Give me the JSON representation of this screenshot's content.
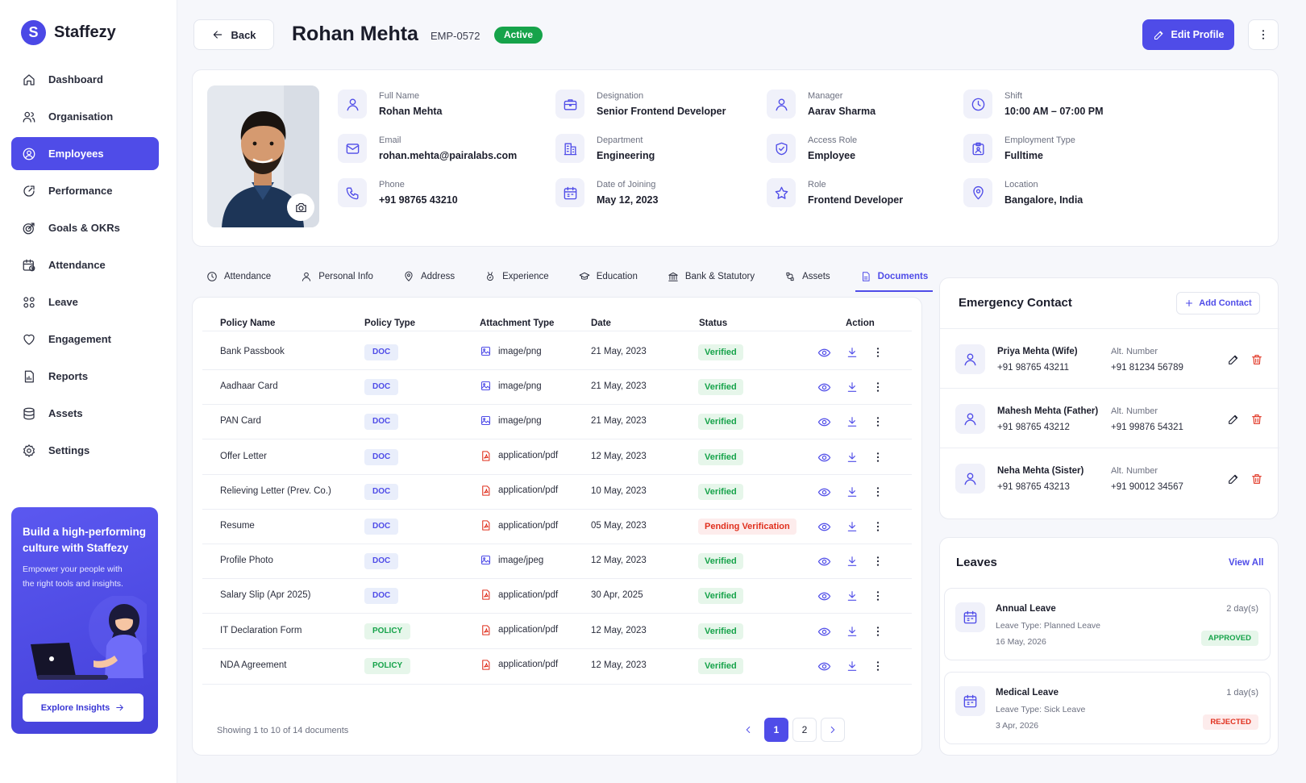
{
  "brand": {
    "logo_letter": "S",
    "name": "Staffezy"
  },
  "nav": [
    {
      "label": "Dashboard",
      "icon": "home-icon"
    },
    {
      "label": "Organisation",
      "icon": "org-icon"
    },
    {
      "label": "Employees",
      "icon": "users-icon",
      "active": true
    },
    {
      "label": "Performance",
      "icon": "gauge-icon"
    },
    {
      "label": "Goals & OKRs",
      "icon": "target-icon"
    },
    {
      "label": "Attendance",
      "icon": "calendar-clock-icon"
    },
    {
      "label": "Leave",
      "icon": "grid-icon"
    },
    {
      "label": "Engagement",
      "icon": "heart-icon"
    },
    {
      "label": "Reports",
      "icon": "file-chart-icon"
    },
    {
      "label": "Assets",
      "icon": "database-icon"
    },
    {
      "label": "Settings",
      "icon": "gear-icon"
    }
  ],
  "promo": {
    "title": "Build a high-performing culture with Staffezy",
    "text": "Empower your people with the right tools and insights.",
    "button": "Explore Insights"
  },
  "header": {
    "back": "Back",
    "name": "Rohan Mehta",
    "code": "EMP-0572",
    "status": "Active",
    "edit": "Edit Profile"
  },
  "profile": {
    "fields": [
      {
        "label": "Full Name",
        "value": "Rohan Mehta",
        "icon": "user-icon"
      },
      {
        "label": "Email",
        "value": "rohan.mehta@pairalabs.com",
        "icon": "mail-icon"
      },
      {
        "label": "Phone",
        "value": "+91 98765 43210",
        "icon": "phone-icon"
      },
      {
        "label": "Designation",
        "value": "Senior Frontend Developer",
        "icon": "briefcase-icon"
      },
      {
        "label": "Department",
        "value": "Engineering",
        "icon": "building-icon"
      },
      {
        "label": "Date of Joining",
        "value": "May 12, 2023",
        "icon": "calendar-icon"
      },
      {
        "label": "Manager",
        "value": "Aarav Sharma",
        "icon": "user-icon"
      },
      {
        "label": "Access Role",
        "value": "Employee",
        "icon": "shield-icon"
      },
      {
        "label": "Role",
        "value": "Frontend Developer",
        "icon": "star-icon"
      },
      {
        "label": "Shift",
        "value": "10:00 AM – 07:00 PM",
        "icon": "clock-icon"
      },
      {
        "label": "Employment Type",
        "value": "Fulltime",
        "icon": "id-badge-icon"
      },
      {
        "label": "Location",
        "value": "Bangalore, India",
        "icon": "pin-icon"
      }
    ]
  },
  "tabs": [
    {
      "label": "Attendance",
      "icon": "clock-icon"
    },
    {
      "label": "Personal Info",
      "icon": "user-icon"
    },
    {
      "label": "Address",
      "icon": "pin-icon"
    },
    {
      "label": "Experience",
      "icon": "medal-icon"
    },
    {
      "label": "Education",
      "icon": "cap-icon"
    },
    {
      "label": "Bank & Statutory",
      "icon": "bank-icon"
    },
    {
      "label": "Assets",
      "icon": "assets-icon"
    },
    {
      "label": "Documents",
      "icon": "document-icon",
      "active": true
    }
  ],
  "documents": {
    "columns": [
      "Policy Name",
      "Policy Type",
      "Attachment Type",
      "Date",
      "Status",
      "Action"
    ],
    "rows": [
      {
        "name": "Bank Passbook",
        "type": "DOC",
        "attachment": "image/png",
        "date": "21 May, 2023",
        "status": "Verified"
      },
      {
        "name": "Aadhaar Card",
        "type": "DOC",
        "attachment": "image/png",
        "date": "21 May, 2023",
        "status": "Verified"
      },
      {
        "name": "PAN Card",
        "type": "DOC",
        "attachment": "image/png",
        "date": "21 May, 2023",
        "status": "Verified"
      },
      {
        "name": "Offer Letter",
        "type": "DOC",
        "attachment": "application/pdf",
        "date": "12 May, 2023",
        "status": "Verified"
      },
      {
        "name": "Relieving Letter (Prev. Co.)",
        "type": "DOC",
        "attachment": "application/pdf",
        "date": "10 May, 2023",
        "status": "Verified"
      },
      {
        "name": "Resume",
        "type": "DOC",
        "attachment": "application/pdf",
        "date": "05 May, 2023",
        "status": "Pending Verification"
      },
      {
        "name": "Profile Photo",
        "type": "DOC",
        "attachment": "image/jpeg",
        "date": "12 May, 2023",
        "status": "Verified"
      },
      {
        "name": "Salary Slip (Apr 2025)",
        "type": "DOC",
        "attachment": "application/pdf",
        "date": "30 Apr, 2025",
        "status": "Verified"
      },
      {
        "name": "IT Declaration Form",
        "type": "POLICY",
        "attachment": "application/pdf",
        "date": "12 May, 2023",
        "status": "Verified"
      },
      {
        "name": "NDA Agreement",
        "type": "POLICY",
        "attachment": "application/pdf",
        "date": "12 May, 2023",
        "status": "Verified"
      }
    ],
    "footer": "Showing 1 to 10 of 14 documents",
    "pages": [
      "1",
      "2"
    ],
    "current_page": "1"
  },
  "emergency": {
    "title": "Emergency Contact",
    "add": "Add Contact",
    "contacts": [
      {
        "name": "Priya Mehta (Wife)",
        "phone": "+91 98765 43211",
        "alt_label": "Alt. Number",
        "alt": "+91 81234 56789"
      },
      {
        "name": "Mahesh Mehta (Father)",
        "phone": "+91 98765 43212",
        "alt_label": "Alt. Number",
        "alt": "+91 99876 54321"
      },
      {
        "name": "Neha Mehta (Sister)",
        "phone": "+91 98765 43213",
        "alt_label": "Alt. Number",
        "alt": "+91 90012 34567"
      }
    ]
  },
  "leaves": {
    "title": "Leaves",
    "view_all": "View All",
    "items": [
      {
        "name": "Annual Leave",
        "type": "Leave Type: Planned Leave",
        "date": "16 May, 2026",
        "days": "2 day(s)",
        "status": "APPROVED"
      },
      {
        "name": "Medical Leave",
        "type": "Leave Type: Sick Leave",
        "date": "3 Apr, 2026",
        "days": "1 day(s)",
        "status": "REJECTED"
      }
    ]
  },
  "colors": {
    "accent": "#4f4ce8",
    "success": "#16a34a",
    "danger": "#e0301e"
  }
}
